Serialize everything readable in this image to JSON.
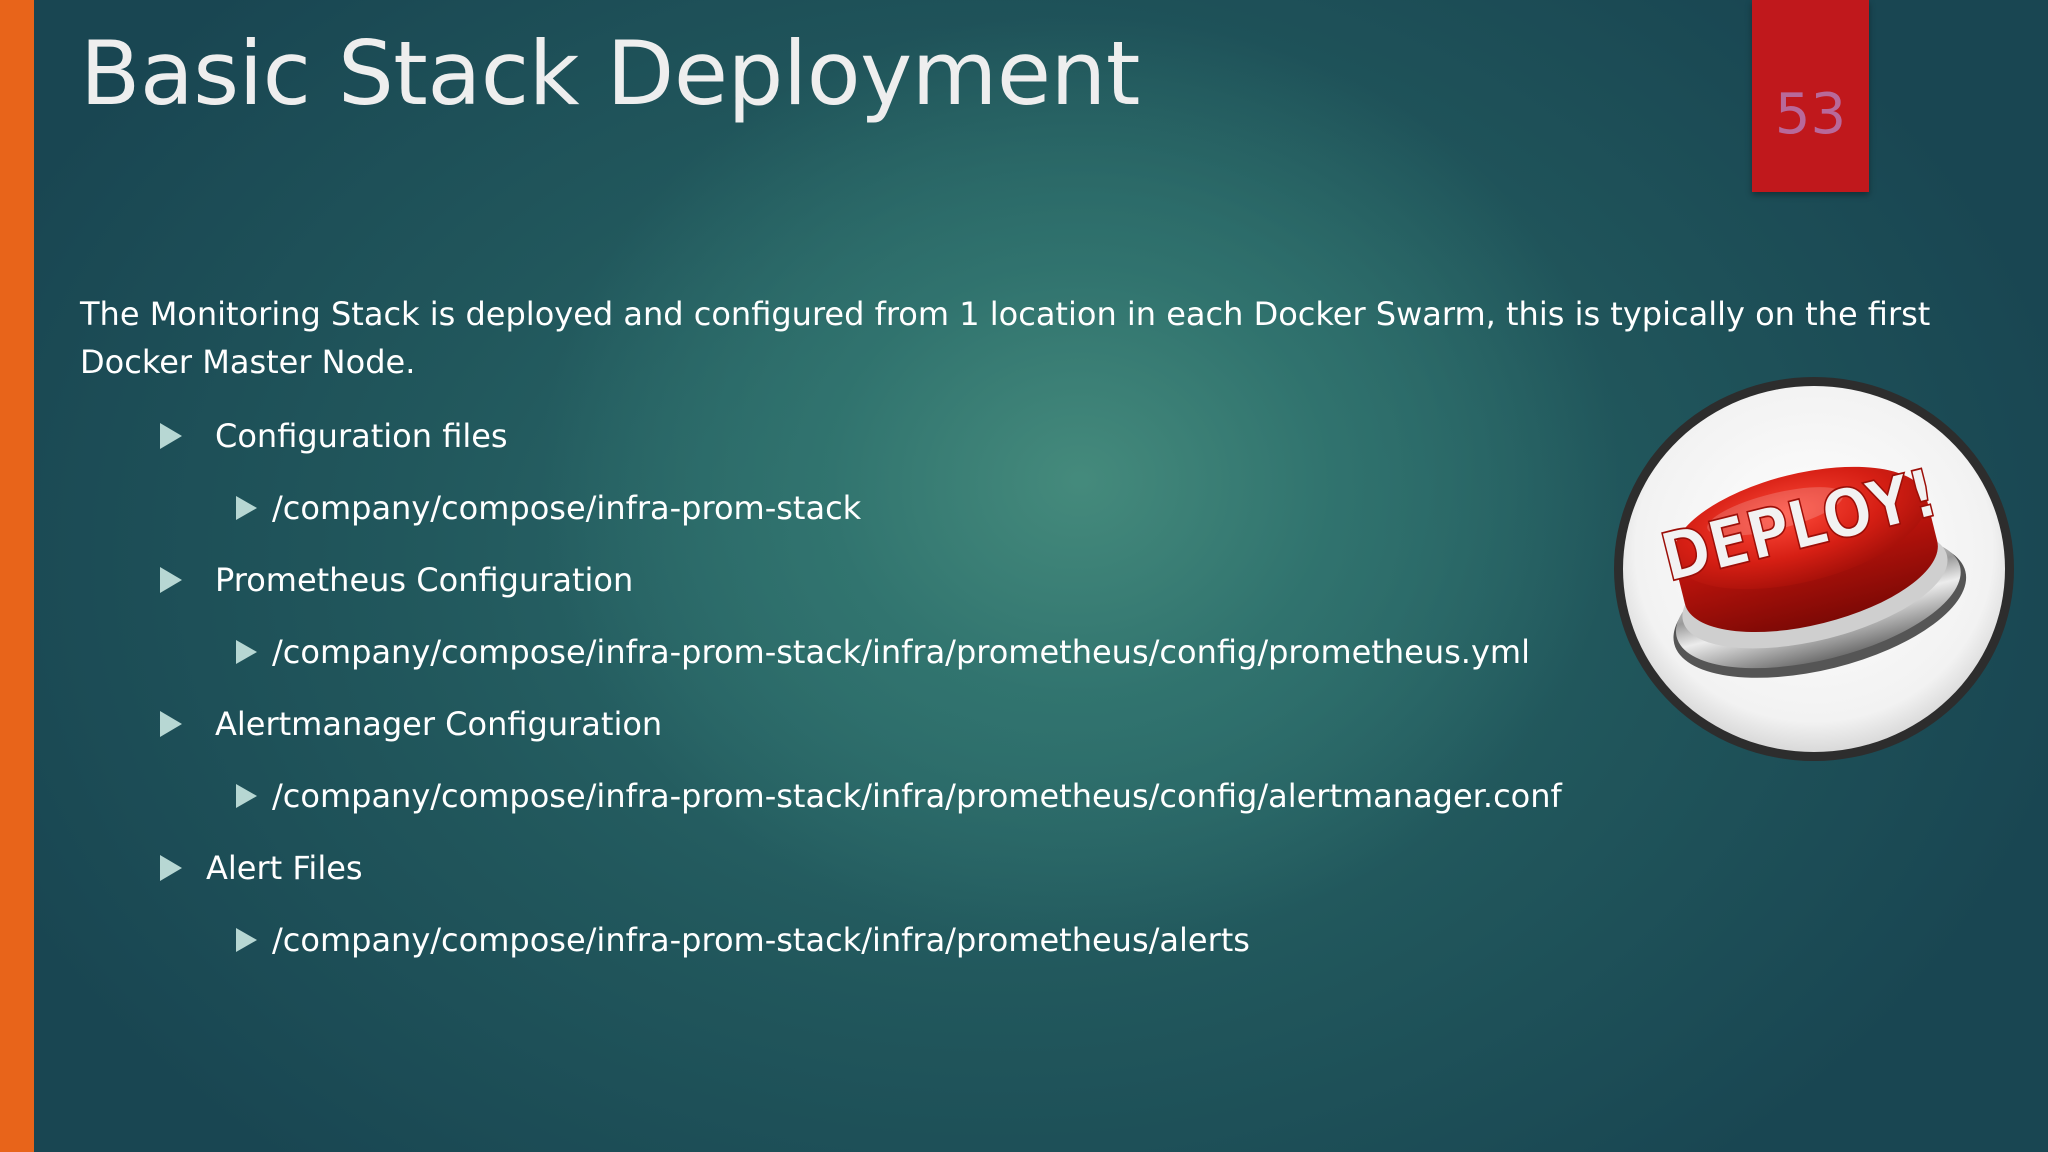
{
  "slide": {
    "title": "Basic Stack Deployment",
    "page_number": "53",
    "intro": "The Monitoring Stack is deployed and configured from 1 location in each Docker Swarm, this is typically on the first Docker Master Node.",
    "bullets": [
      {
        "label": "Configuration files",
        "sub": "/company/compose/infra-prom-stack"
      },
      {
        "label": "Prometheus Configuration",
        "sub": "/company/compose/infra-prom-stack/infra/prometheus/config/prometheus.yml"
      },
      {
        "label": "Alertmanager Configuration",
        "sub": "/company/compose/infra-prom-stack/infra/prometheus/config/alertmanager.conf"
      },
      {
        "label": "Alert Files",
        "sub": "/company/compose/infra-prom-stack/infra/prometheus/alerts"
      }
    ],
    "deploy_button_text": "DEPLOY!"
  },
  "colors": {
    "accent_bar": "#e8641a",
    "page_number_box": "#c0181c",
    "background": "#21575c",
    "bullet": "#b7d7d3"
  },
  "icons": {
    "bullet": "triangle-right-icon",
    "image": "deploy-button-image"
  }
}
